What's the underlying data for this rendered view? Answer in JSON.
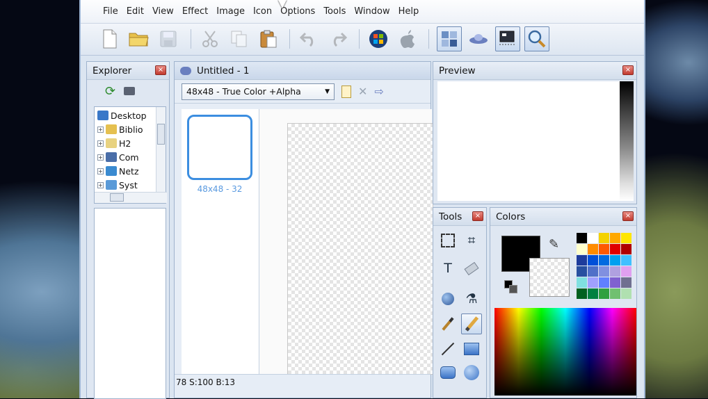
{
  "menu": [
    "File",
    "Edit",
    "View",
    "Effect",
    "Image",
    "Icon",
    "Options",
    "Tools",
    "Window",
    "Help"
  ],
  "toolbar": {
    "buttons": [
      "new-file-icon",
      "open-folder-icon",
      "save-icon",
      "cut-icon",
      "copy-icon",
      "paste-icon",
      "undo-icon",
      "redo-icon",
      "windows-logo-icon",
      "apple-logo-icon",
      "icon-grid-icon",
      "ufo-icon",
      "screen-capture-icon",
      "zoom-icon"
    ]
  },
  "explorer": {
    "title": "Explorer",
    "close": "×",
    "items": [
      "Desktop",
      "Biblio",
      "H2",
      "Com",
      "Netz",
      "Syst"
    ]
  },
  "document": {
    "title": "Untitled - 1",
    "format_select": "48x48 - True Color +Alpha",
    "thumbnail_label": "48x48 - 32",
    "status": "78 S:100 B:13"
  },
  "preview": {
    "title": "Preview",
    "close": "×"
  },
  "tools_panel": {
    "title": "Tools",
    "close": "×"
  },
  "colors_panel": {
    "title": "Colors",
    "close": "×",
    "primary_color": "#000000",
    "secondary_color": "transparent"
  },
  "palette": [
    "#000000",
    "#ffffff",
    "#f4d200",
    "#ffa800",
    "#ffe600",
    "#ffffcc",
    "#ff8c00",
    "#ff5a00",
    "#e00000",
    "#b00000",
    "#1e3c9c",
    "#0050d8",
    "#006be0",
    "#00a0f0",
    "#40c0ff",
    "#2850a0",
    "#5070c8",
    "#8090e0",
    "#b0a0e0",
    "#e0a0f0",
    "#80e0e0",
    "#a0a0ff",
    "#6080ff",
    "#8060d0",
    "#707090",
    "#006020",
    "#008040",
    "#30a040",
    "#70c070",
    "#b0e0b0"
  ]
}
